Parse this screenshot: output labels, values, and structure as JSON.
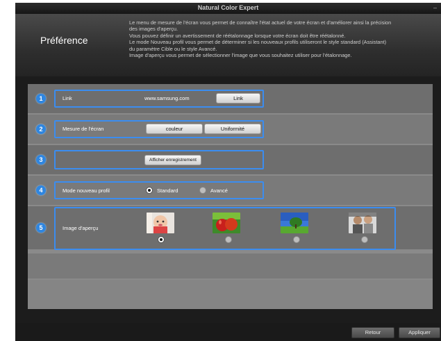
{
  "window": {
    "title": "Natural Color Expert",
    "min_glyph": "–"
  },
  "header": {
    "title": "Préférence",
    "description": [
      "Le menu de mesure de l'écran vous permet de connaître l'état actuel de votre écran et d'améliorer ainsi la précision",
      "des images d'aperçu.",
      "Vous pouvez définir un avertissement de réétalonnage lorsque votre écran doit être réétalonné.",
      "Le mode Nouveau profil vous permet de déterminer si les nouveaux profils utiliseront le style standard (Assistant)",
      "du paramètre Cible ou le style Avancé.",
      "Image d'aperçu vous permet de sélectionner l'image que vous souhaitez utiliser pour l'étalonnage."
    ]
  },
  "rows": {
    "link": {
      "number": "1",
      "label": "Link",
      "url": "www.samsung.com",
      "button": "Link"
    },
    "measure": {
      "number": "2",
      "label": "Mesure de l'écran",
      "buttons": [
        "couleur",
        "Uniformité"
      ]
    },
    "record": {
      "number": "3",
      "button": "Afficher enregistrement"
    },
    "mode": {
      "number": "4",
      "label": "Mode nouveau profil",
      "options": [
        "Standard",
        "Avancé"
      ],
      "selected": "Standard"
    },
    "preview": {
      "number": "5",
      "label": "Image d'aperçu",
      "images": [
        "baby-photo",
        "apples-photo",
        "tree-landscape-photo",
        "children-photo"
      ],
      "selected_index": 0
    }
  },
  "footer": {
    "back": "Retour",
    "apply": "Appliquer"
  },
  "colors": {
    "accent": "#3b8df0",
    "number_badge": "#2f86e0",
    "panel": "#8a8a8a",
    "row": "#6e6e6e"
  }
}
